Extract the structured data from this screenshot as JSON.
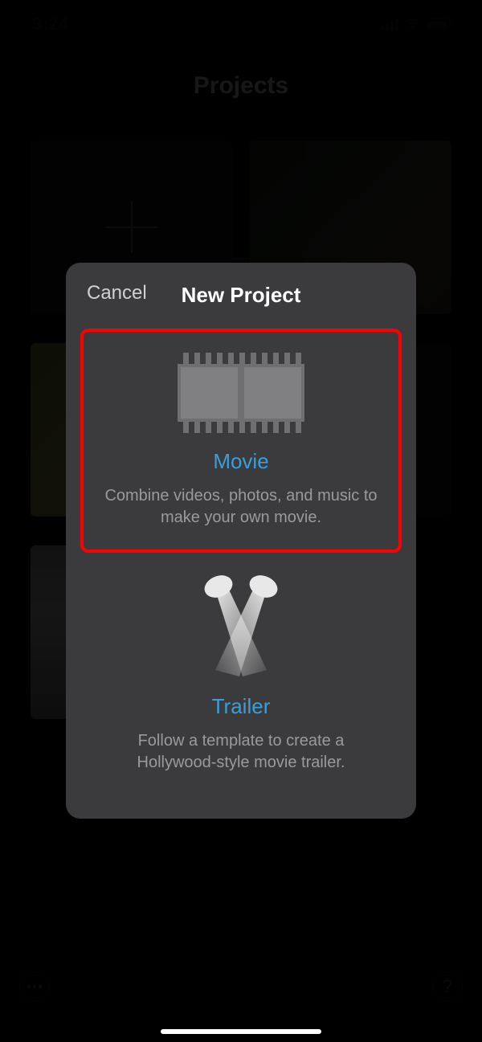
{
  "status_bar": {
    "time": "9:24"
  },
  "page": {
    "title": "Projects"
  },
  "sheet": {
    "cancel_label": "Cancel",
    "title": "New Project",
    "options": [
      {
        "title": "Movie",
        "description": "Combine videos, photos, and music to make your own movie."
      },
      {
        "title": "Trailer",
        "description": "Follow a template to create a Hollywood-style movie trailer."
      }
    ]
  },
  "help_label": "?",
  "colors": {
    "accent": "#3a9fd8",
    "highlight_box": "#ff0000",
    "sheet_bg": "#3b3b3d"
  }
}
